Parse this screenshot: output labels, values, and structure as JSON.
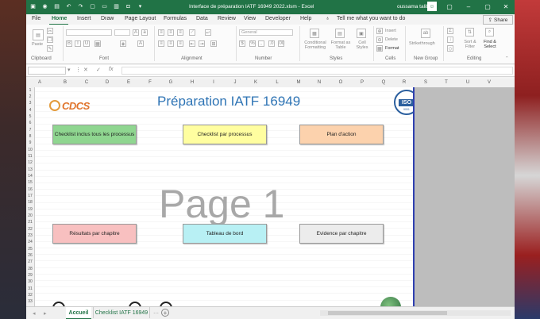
{
  "titlebar": {
    "title": "Interface de préparation IATF 16949 2022.xlsm  -  Excel",
    "user": "oussama talibi",
    "avatar_initial": "☺"
  },
  "menu": {
    "items": [
      "File",
      "Home",
      "Insert",
      "Draw",
      "Page Layout",
      "Formulas",
      "Data",
      "Review",
      "View",
      "Developer",
      "Help"
    ],
    "active": "Home",
    "tell_me": "Tell me what you want to do",
    "share": "Share"
  },
  "ribbon": {
    "clipboard": "Clipboard",
    "font": "Font",
    "alignment": "Alignment",
    "number": "Number",
    "styles": "Styles",
    "cells": "Cells",
    "new_group": "New Group",
    "editing": "Editing",
    "paste": "Paste",
    "number_format": "General",
    "conditional": "Conditional Formatting",
    "format_as_table": "Format as Table",
    "cell_styles": "Cell Styles",
    "insert": "Insert",
    "delete": "Delete",
    "format": "Format",
    "strikethrough": "Strikethrough",
    "sort_filter": "Sort & Filter",
    "find_select": "Find & Select"
  },
  "formula_bar": {
    "fx": "fx",
    "value": ""
  },
  "columns": [
    "A",
    "B",
    "C",
    "D",
    "E",
    "F",
    "G",
    "H",
    "I",
    "J",
    "K",
    "L",
    "M",
    "N",
    "O",
    "P",
    "Q",
    "R",
    "S",
    "T",
    "U",
    "V"
  ],
  "rows": [
    "1",
    "2",
    "3",
    "4",
    "5",
    "6",
    "7",
    "8",
    "9",
    "10",
    "11",
    "12",
    "13",
    "14",
    "15",
    "16",
    "17",
    "18",
    "19",
    "20",
    "21",
    "22",
    "23",
    "24",
    "25",
    "26",
    "27",
    "28",
    "29",
    "30",
    "31",
    "32",
    "33"
  ],
  "sheet": {
    "logo": "CDCS",
    "title": "Préparation IATF 16949",
    "iso": "ISO",
    "iso_number": "9001",
    "watermark": "Page 1",
    "buttons": {
      "b1": "Checklist inclus tous les processus",
      "b2": "Checklist par processus",
      "b3": "Plan d'action",
      "b4": "Résultats par chapitre",
      "b5": "Tableau de bord",
      "b6": "Evidence par chapitre"
    }
  },
  "tabs": {
    "active": "Accueil",
    "second": "Checklist IATF 16949",
    "add": "+"
  }
}
